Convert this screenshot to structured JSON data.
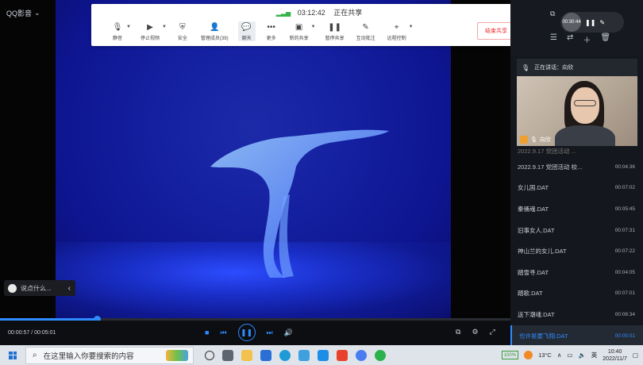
{
  "player": {
    "app_title": "QQ影音",
    "title_chevron": "⌄",
    "current_time": "00:00:57",
    "time_separator": " / ",
    "total_time": "00:05:01",
    "progress": 0.19,
    "say_placeholder": "说点什么..."
  },
  "toolbar": {
    "signal_icon": "signal-bars-icon",
    "elapsed": "03:12:42",
    "status_text": "正在共享",
    "items": [
      {
        "label": "静音",
        "icon": "mic-icon",
        "caret": true
      },
      {
        "label": "停止视频",
        "icon": "camera-icon",
        "caret": true
      },
      {
        "label": "安全",
        "icon": "shield-icon",
        "caret": false
      },
      {
        "label": "管理成员(39)",
        "icon": "members-icon",
        "caret": false
      },
      {
        "label": "聊天",
        "icon": "chat-icon",
        "caret": false,
        "active": true
      },
      {
        "label": "更多",
        "icon": "more-icon",
        "caret": false
      },
      {
        "label": "新的共享",
        "icon": "share-screen-icon",
        "caret": true
      },
      {
        "label": "暂停共享",
        "icon": "pause-share-icon",
        "caret": false
      },
      {
        "label": "互动批注",
        "icon": "annotate-icon",
        "caret": false
      },
      {
        "label": "远程控制",
        "icon": "remote-control-icon",
        "caret": true
      }
    ],
    "end_share_label": "结束共享"
  },
  "panel": {
    "recording_time": "00:30:44",
    "speaking_label": "正在讲话：向欣",
    "camera_name": "向欣",
    "playlist": [
      {
        "name": "2022.9.17 党团活动 ...",
        "duration": "",
        "partial": true
      },
      {
        "name": "2022.9.17 党团活动 校...",
        "duration": "00:04:36"
      },
      {
        "name": "女儿国.DAT",
        "duration": "00:07:02"
      },
      {
        "name": "秦俑魂.DAT",
        "duration": "00:05:45"
      },
      {
        "name": "旧事女人.DAT",
        "duration": "00:07:31"
      },
      {
        "name": "神山兰的女儿.DAT",
        "duration": "00:07:22"
      },
      {
        "name": "踏雪寻.DAT",
        "duration": "00:04:05"
      },
      {
        "name": "踏歌.DAT",
        "duration": "00:07:01"
      },
      {
        "name": "送下潮魂.DAT",
        "duration": "00:08:34"
      },
      {
        "name": "也许是要飞翔.DAT",
        "duration": "00:05:01",
        "current": true
      }
    ]
  },
  "taskbar": {
    "search_placeholder": "在这里输入你要搜索的内容",
    "battery": "100%",
    "temperature": "13°C",
    "ime": "英",
    "time": "10:40",
    "date": "2022/11/7"
  },
  "colors": {
    "accent": "#2f8cff",
    "end_share": "#e33333"
  }
}
